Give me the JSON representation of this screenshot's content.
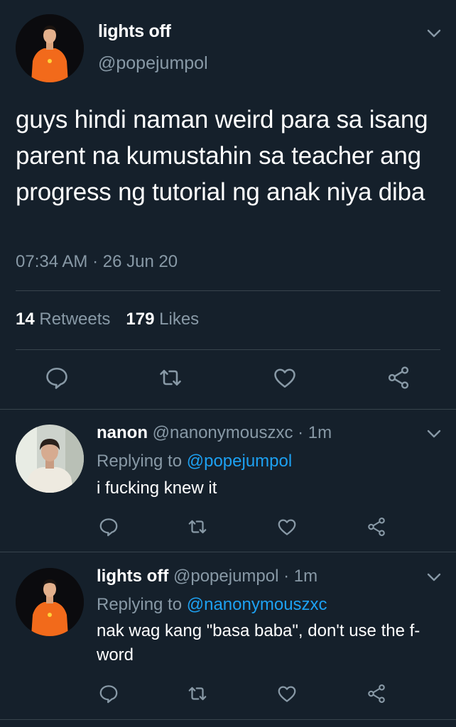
{
  "main_tweet": {
    "display_name": "lights off",
    "handle": "@popejumpol",
    "text": "guys hindi naman weird para sa isang parent na kumustahin sa teacher ang progress ng tutorial ng anak niya diba",
    "timestamp": "07:34 AM · 26 Jun 20",
    "retweets_count": "14",
    "retweets_label": "Retweets",
    "likes_count": "179",
    "likes_label": "Likes",
    "actions": [
      "reply-icon",
      "retweet-icon",
      "like-icon",
      "share-icon"
    ]
  },
  "replies": [
    {
      "display_name": "nanon",
      "handle": "@nanonymouszxc",
      "time": "· 1m",
      "replying_prefix": "Replying to",
      "replying_to": "@popejumpol",
      "text": "i fucking knew it"
    },
    {
      "display_name": "lights off",
      "handle": "@popejumpol",
      "time": "· 1m",
      "replying_prefix": "Replying to",
      "replying_to": "@nanonymouszxc",
      "text": "nak wag kang \"basa baba\", don't use the f-word"
    }
  ],
  "colors": {
    "background": "#15202b",
    "text_primary": "#ffffff",
    "text_muted": "#8899a6",
    "accent": "#1da1f2",
    "divider": "#38444d"
  }
}
